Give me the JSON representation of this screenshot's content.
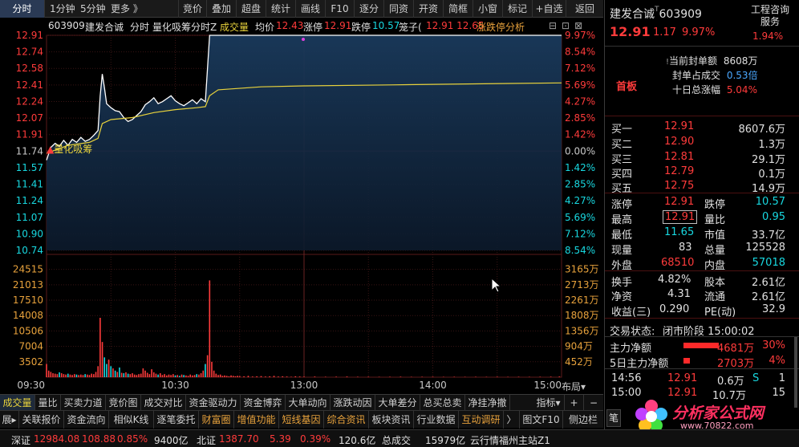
{
  "toolbar": {
    "left_tabs": [
      "分时",
      "1分钟",
      "5分钟",
      "更多 》"
    ],
    "buttons": [
      "竞价",
      "叠加",
      "超盘",
      "统计",
      "画线",
      "F10",
      "逐分",
      "同资",
      "开资",
      "简框",
      "小窗",
      "标记",
      "+自选",
      "返回"
    ]
  },
  "chart_header": {
    "code": "603909",
    "name": "建发合诚",
    "mode": "分时",
    "indicator": "量化吸筹分时Z",
    "volume_label": "成交量",
    "avg_label": "均价",
    "avg_value": "12.43",
    "limit_up_label": "涨停",
    "limit_up_value": "12.91",
    "limit_down_label": "跌停",
    "limit_down_value": "10.57",
    "cage_label": "笼子(",
    "cage_value": "12.91 12.65",
    "analysis_label": "涨跌停分析"
  },
  "chart_data": {
    "type": "line",
    "prev_close": 11.74,
    "price_ticks_left": [
      "12.91",
      "12.74",
      "12.58",
      "12.41",
      "12.24",
      "12.07",
      "11.91",
      "11.74",
      "11.57",
      "11.41",
      "11.24",
      "11.07",
      "10.90",
      "10.74"
    ],
    "price_ticks_right": [
      "9.97%",
      "8.54%",
      "7.12%",
      "5.69%",
      "4.27%",
      "2.85%",
      "1.42%",
      "0.00%",
      "1.42%",
      "2.85%",
      "4.27%",
      "5.69%",
      "7.12%",
      "8.54%"
    ],
    "volume_ticks_left": [
      "24515",
      "21013",
      "17510",
      "14008",
      "10506",
      "7004",
      "3502"
    ],
    "volume_ticks_right": [
      "3165万",
      "2713万",
      "2261万",
      "1808万",
      "1356万",
      "904万",
      "452万"
    ],
    "time_labels": [
      "09:30",
      "10:30",
      "13:00",
      "14:00",
      "15:00"
    ],
    "annotation": "量化吸筹",
    "price_series": [
      [
        0,
        11.65
      ],
      [
        2,
        11.78
      ],
      [
        4,
        11.82
      ],
      [
        6,
        11.79
      ],
      [
        8,
        11.85
      ],
      [
        10,
        11.8
      ],
      [
        12,
        11.86
      ],
      [
        14,
        11.83
      ],
      [
        16,
        11.88
      ],
      [
        18,
        11.84
      ],
      [
        20,
        11.86
      ],
      [
        22,
        11.9
      ],
      [
        24,
        11.95
      ],
      [
        25,
        12.3
      ],
      [
        26,
        12.52
      ],
      [
        27,
        12.38
      ],
      [
        28,
        12.22
      ],
      [
        30,
        12.18
      ],
      [
        32,
        12.15
      ],
      [
        34,
        12.14
      ],
      [
        36,
        12.08
      ],
      [
        38,
        12.04
      ],
      [
        40,
        12.06
      ],
      [
        42,
        12.1
      ],
      [
        44,
        12.14
      ],
      [
        46,
        12.21
      ],
      [
        48,
        12.24
      ],
      [
        50,
        12.28
      ],
      [
        52,
        12.22
      ],
      [
        54,
        12.24
      ],
      [
        56,
        12.27
      ],
      [
        58,
        12.3
      ],
      [
        60,
        12.25
      ],
      [
        62,
        12.22
      ],
      [
        64,
        12.2
      ],
      [
        66,
        12.23
      ],
      [
        68,
        12.26
      ],
      [
        70,
        12.22
      ],
      [
        72,
        12.27
      ],
      [
        74,
        12.24
      ],
      [
        76,
        12.91
      ],
      [
        80,
        12.91
      ],
      [
        120,
        12.91
      ],
      [
        240,
        12.91
      ]
    ],
    "avg_series": [
      [
        0,
        11.72
      ],
      [
        10,
        11.8
      ],
      [
        20,
        11.83
      ],
      [
        24,
        11.87
      ],
      [
        26,
        12.02
      ],
      [
        30,
        12.06
      ],
      [
        40,
        12.08
      ],
      [
        50,
        12.13
      ],
      [
        60,
        12.16
      ],
      [
        70,
        12.18
      ],
      [
        74,
        12.19
      ],
      [
        76,
        12.3
      ],
      [
        80,
        12.36
      ],
      [
        100,
        12.39
      ],
      [
        120,
        12.4
      ],
      [
        160,
        12.41
      ],
      [
        200,
        12.42
      ],
      [
        240,
        12.43
      ]
    ],
    "volume_bars": [
      [
        0,
        3000
      ],
      [
        1,
        1500
      ],
      [
        2,
        1200
      ],
      [
        3,
        900
      ],
      [
        4,
        800
      ],
      [
        5,
        700
      ],
      [
        6,
        1100
      ],
      [
        7,
        900
      ],
      [
        8,
        700
      ],
      [
        9,
        600
      ],
      [
        10,
        800
      ],
      [
        11,
        600
      ],
      [
        12,
        500
      ],
      [
        13,
        700
      ],
      [
        14,
        600
      ],
      [
        15,
        500
      ],
      [
        16,
        600
      ],
      [
        17,
        500
      ],
      [
        18,
        700
      ],
      [
        19,
        600
      ],
      [
        20,
        500
      ],
      [
        21,
        800
      ],
      [
        22,
        700
      ],
      [
        23,
        1200
      ],
      [
        24,
        2500
      ],
      [
        25,
        13500
      ],
      [
        26,
        8000
      ],
      [
        27,
        4500
      ],
      [
        28,
        3000
      ],
      [
        29,
        4000
      ],
      [
        30,
        2500
      ],
      [
        31,
        2000
      ],
      [
        32,
        1500
      ],
      [
        33,
        1200
      ],
      [
        34,
        2200
      ],
      [
        35,
        1000
      ],
      [
        36,
        900
      ],
      [
        37,
        1100
      ],
      [
        38,
        800
      ],
      [
        39,
        700
      ],
      [
        40,
        900
      ],
      [
        41,
        600
      ],
      [
        42,
        500
      ],
      [
        43,
        700
      ],
      [
        44,
        800
      ],
      [
        45,
        2000
      ],
      [
        46,
        1500
      ],
      [
        47,
        1000
      ],
      [
        48,
        700
      ],
      [
        49,
        1800
      ],
      [
        50,
        1100
      ],
      [
        51,
        800
      ],
      [
        52,
        600
      ],
      [
        53,
        900
      ],
      [
        54,
        500
      ],
      [
        55,
        700
      ],
      [
        56,
        400
      ],
      [
        57,
        600
      ],
      [
        58,
        500
      ],
      [
        59,
        700
      ],
      [
        60,
        400
      ],
      [
        61,
        500
      ],
      [
        62,
        300
      ],
      [
        63,
        600
      ],
      [
        64,
        500
      ],
      [
        65,
        400
      ],
      [
        66,
        300
      ],
      [
        67,
        600
      ],
      [
        68,
        400
      ],
      [
        69,
        500
      ],
      [
        70,
        700
      ],
      [
        71,
        600
      ],
      [
        72,
        900
      ],
      [
        73,
        1500
      ],
      [
        74,
        3000
      ],
      [
        75,
        5000
      ],
      [
        76,
        22000
      ],
      [
        77,
        3500
      ],
      [
        78,
        1500
      ],
      [
        79,
        800
      ],
      [
        80,
        500
      ],
      [
        81,
        600
      ],
      [
        82,
        300
      ],
      [
        83,
        400
      ],
      [
        84,
        300
      ],
      [
        85,
        200
      ],
      [
        86,
        400
      ],
      [
        87,
        300
      ],
      [
        88,
        200
      ],
      [
        89,
        300
      ],
      [
        90,
        250
      ],
      [
        92,
        200
      ],
      [
        94,
        300
      ],
      [
        96,
        150
      ],
      [
        98,
        200
      ],
      [
        100,
        250
      ],
      [
        102,
        150
      ],
      [
        104,
        200
      ],
      [
        106,
        300
      ],
      [
        108,
        150
      ],
      [
        110,
        200
      ],
      [
        112,
        150
      ],
      [
        114,
        100
      ],
      [
        116,
        200
      ],
      [
        118,
        150
      ],
      [
        120,
        120
      ],
      [
        125,
        150
      ],
      [
        130,
        100
      ],
      [
        135,
        120
      ],
      [
        140,
        150
      ],
      [
        145,
        100
      ],
      [
        150,
        120
      ],
      [
        155,
        80
      ],
      [
        160,
        100
      ],
      [
        165,
        120
      ],
      [
        170,
        80
      ],
      [
        175,
        100
      ],
      [
        180,
        120
      ],
      [
        185,
        80
      ],
      [
        190,
        100
      ],
      [
        195,
        80
      ],
      [
        200,
        100
      ],
      [
        205,
        80
      ],
      [
        210,
        120
      ],
      [
        215,
        80
      ],
      [
        220,
        100
      ],
      [
        225,
        80
      ],
      [
        230,
        100
      ],
      [
        235,
        120
      ],
      [
        239,
        150
      ]
    ]
  },
  "quote": {
    "name": "建发合诚",
    "code": "603909",
    "price": "12.91",
    "change": "1.17",
    "pct": "9.97%",
    "service_label": "工程咨询\n服务",
    "sector_pct": "1.94%",
    "first_board": "首板",
    "seal_label": "当前封单额",
    "seal_value": "8608万",
    "seal_ratio_label": "封单占成交",
    "seal_ratio_value": "0.53倍",
    "ten_day_label": "十日总涨幅",
    "ten_day_value": "5.04%"
  },
  "order_book": [
    {
      "label": "买一",
      "price": "12.91",
      "vol": "8607.6万"
    },
    {
      "label": "买二",
      "price": "12.90",
      "vol": "1.3万"
    },
    {
      "label": "买三",
      "price": "12.81",
      "vol": "29.1万"
    },
    {
      "label": "买四",
      "price": "12.79",
      "vol": "0.1万"
    },
    {
      "label": "买五",
      "price": "12.75",
      "vol": "14.9万"
    }
  ],
  "stats": [
    {
      "l1": "涨停",
      "v1": "12.91",
      "l2": "跌停",
      "v2": "10.57"
    },
    {
      "l1": "最高",
      "v1": "12.91",
      "l2": "量比",
      "v2": "0.95"
    },
    {
      "l1": "最低",
      "v1": "11.65",
      "l2": "市值",
      "v2": "33.7亿"
    },
    {
      "l1": "现量",
      "v1": "83",
      "l2": "总量",
      "v2": "125528"
    },
    {
      "l1": "外盘",
      "v1": "68510",
      "l2": "内盘",
      "v2": "57018"
    }
  ],
  "fin": [
    {
      "l1": "换手",
      "v1": "4.82%",
      "l2": "股本",
      "v2": "2.61亿"
    },
    {
      "l1": "净资",
      "v1": "4.31",
      "l2": "流通",
      "v2": "2.61亿"
    },
    {
      "l1": "收益(三)",
      "v1": "0.290",
      "l2": "PE(动)",
      "v2": "32.9"
    }
  ],
  "trade_state": {
    "label": "交易状态:",
    "value": "闭市阶段 15:00:02"
  },
  "flows": [
    {
      "label": "主力净额",
      "value": "4681万",
      "pct": "30%"
    },
    {
      "label": "5日主力净额",
      "value": "2703万",
      "pct": "4%"
    }
  ],
  "ticks": [
    {
      "time": "14:56",
      "price": "12.91",
      "vol": "0.6万",
      "flag": "S",
      "n": "1"
    },
    {
      "time": "15:00",
      "price": "12.91",
      "vol": "10.7万",
      "flag": "",
      "n": "15"
    }
  ],
  "tabs_row1": [
    "成交量",
    "量比",
    "买卖力道",
    "竞价图",
    "成交对比",
    "资金驱动力",
    "资金博弈",
    "大单动向",
    "涨跌动因",
    "大单差分",
    "总买总卖",
    "净挂净撤",
    "指标▾",
    "+",
    "−"
  ],
  "tabs_row2": [
    "展▸",
    "关联报价",
    "资金流向",
    "相似K线",
    "逐笔委托",
    "财富圈",
    "增值功能",
    "短线基因",
    "综合资讯",
    "板块资讯",
    "行业数据",
    "互动调研",
    "〉",
    "图文F10",
    "侧边栏"
  ],
  "layout_label": "布局▾",
  "side_tab": "笔",
  "status": {
    "sz_label": "深证",
    "sz_value": "12984.08",
    "sz_change": "108.88",
    "sz_pct": "0.85%",
    "sz_amount": "9400亿",
    "bz_label": "北证",
    "bz_value": "1387.70",
    "bz_change": "5.39",
    "bz_pct": "0.39%",
    "bz_amount": "120.6亿",
    "total_label": "总成交",
    "total_value": "15979亿",
    "server": "云行情福州主站Z1"
  },
  "watermark": {
    "text": "分析家公式网",
    "url": "www.70822.com"
  }
}
